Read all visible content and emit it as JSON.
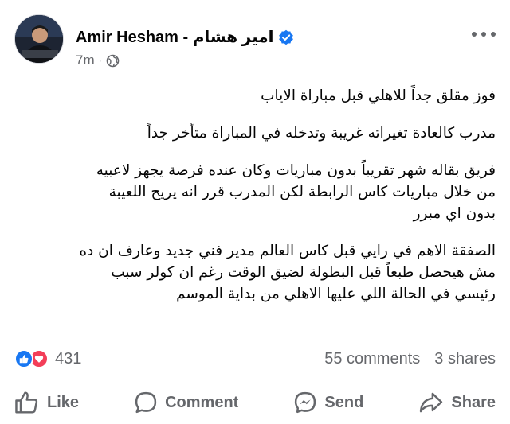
{
  "post": {
    "author": "Amir Hesham - امير هشام",
    "time": "7m",
    "separator": "·",
    "audience_icon": "globe-icon",
    "verified_icon": "verified-badge-icon",
    "paragraphs": [
      [
        "فوز مقلق جداً للاهلي قبل مباراة الاياب"
      ],
      [
        "مدرب كالعادة تغيراته غريبة وتدخله في المباراة متأخر جداً"
      ],
      [
        "فريق بقاله شهر تقريباً بدون مباريات وكان عنده فرصة يجهز لاعبيه",
        "من خلال مباريات كاس الرابطة لكن المدرب قرر انه يريح اللعيبة",
        "بدون اي مبرر"
      ],
      [
        "الصفقة الاهم في رايي قبل كاس العالم مدير فني جديد وعارف ان ده",
        "مش هيحصل طبعاً قبل البطولة لضيق الوقت رغم ان كولر سبب",
        "رئيسي في الحالة اللي عليها الاهلي من بداية الموسم"
      ]
    ]
  },
  "stats": {
    "reaction_count": "431",
    "comments": "55 comments",
    "shares": "3 shares",
    "reaction_icons": [
      "like-reaction-icon",
      "love-reaction-icon"
    ]
  },
  "actions": {
    "like": "Like",
    "comment": "Comment",
    "send": "Send",
    "share": "Share"
  },
  "colors": {
    "primary_text": "#050505",
    "secondary_text": "#65676b",
    "facebook_blue": "#1877f2",
    "love_red": "#f33e58"
  }
}
